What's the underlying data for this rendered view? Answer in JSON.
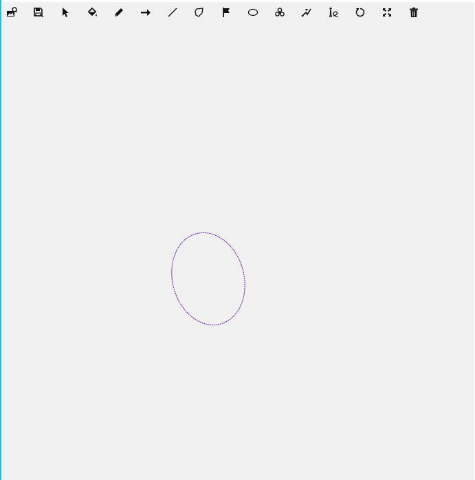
{
  "toolbar": {
    "tools": [
      {
        "name": "open-image-icon"
      },
      {
        "name": "save-icon"
      },
      {
        "name": "select-pointer-icon"
      },
      {
        "name": "paint-bucket-icon"
      },
      {
        "name": "pencil-icon"
      },
      {
        "name": "arrow-icon"
      },
      {
        "name": "line-icon"
      },
      {
        "name": "polygon-icon"
      },
      {
        "name": "flag-icon"
      },
      {
        "name": "ellipse-icon"
      },
      {
        "name": "triskelion-icon"
      },
      {
        "name": "path-tool-icon"
      },
      {
        "name": "figure-icon"
      },
      {
        "name": "rotate-icon"
      },
      {
        "name": "fullscreen-icon"
      },
      {
        "name": "trash-icon"
      }
    ]
  },
  "canvas": {
    "background": "#f0f0f0",
    "shapes": [
      {
        "type": "ellipse",
        "stroke": "#6a0dad"
      }
    ]
  },
  "colors": {
    "accent_border": "#19c3d3",
    "icon": "#111111"
  }
}
